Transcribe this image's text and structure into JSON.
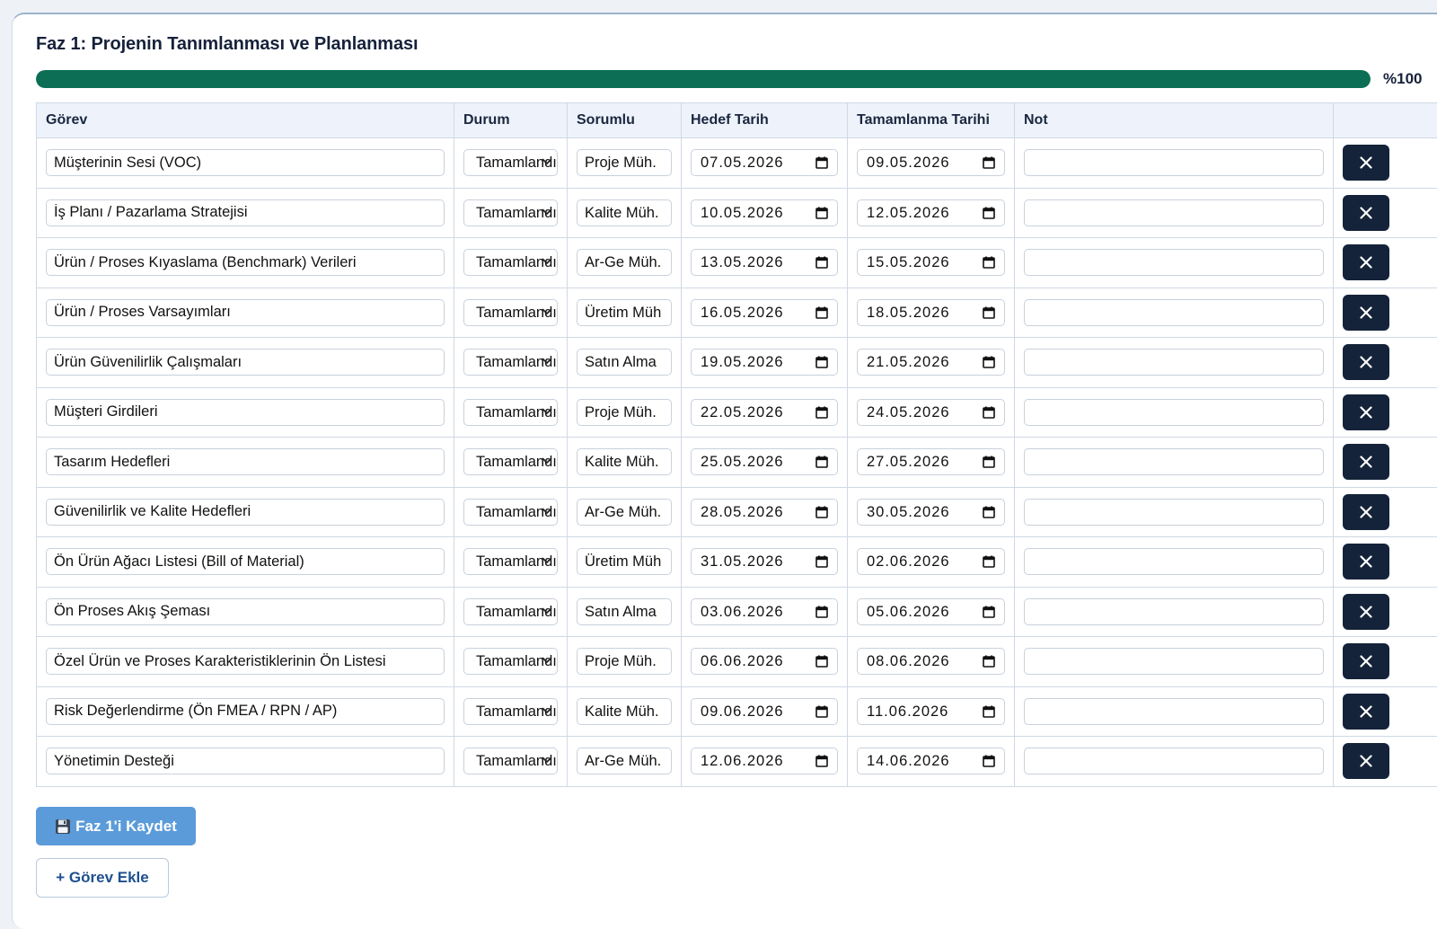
{
  "phase": {
    "title": "Faz 1: Projenin Tanımlanması ve Planlanması",
    "progress_percent": 100,
    "progress_label": "%100"
  },
  "table": {
    "headers": [
      "Görev",
      "Durum",
      "Sorumlu",
      "Hedef Tarih",
      "Tamamlanma Tarihi",
      "Not",
      ""
    ],
    "rows": [
      {
        "task": "Müşterinin Sesi (VOC)",
        "status": "Tamamlandı",
        "responsible": "Proje Müh.",
        "target_date": "07.05.2026",
        "completion_date": "09.05.2026",
        "note": ""
      },
      {
        "task": "İş Planı / Pazarlama Stratejisi",
        "status": "Tamamlandı",
        "responsible": "Kalite Müh.",
        "target_date": "10.05.2026",
        "completion_date": "12.05.2026",
        "note": ""
      },
      {
        "task": "Ürün / Proses Kıyaslama (Benchmark) Verileri",
        "status": "Tamamlandı",
        "responsible": "Ar-Ge Müh.",
        "target_date": "13.05.2026",
        "completion_date": "15.05.2026",
        "note": ""
      },
      {
        "task": "Ürün / Proses Varsayımları",
        "status": "Tamamlandı",
        "responsible": "Üretim Müh",
        "target_date": "16.05.2026",
        "completion_date": "18.05.2026",
        "note": ""
      },
      {
        "task": "Ürün Güvenilirlik Çalışmaları",
        "status": "Tamamlandı",
        "responsible": "Satın Alma",
        "target_date": "19.05.2026",
        "completion_date": "21.05.2026",
        "note": ""
      },
      {
        "task": "Müşteri Girdileri",
        "status": "Tamamlandı",
        "responsible": "Proje Müh.",
        "target_date": "22.05.2026",
        "completion_date": "24.05.2026",
        "note": ""
      },
      {
        "task": "Tasarım Hedefleri",
        "status": "Tamamlandı",
        "responsible": "Kalite Müh.",
        "target_date": "25.05.2026",
        "completion_date": "27.05.2026",
        "note": ""
      },
      {
        "task": "Güvenilirlik ve Kalite Hedefleri",
        "status": "Tamamlandı",
        "responsible": "Ar-Ge Müh.",
        "target_date": "28.05.2026",
        "completion_date": "30.05.2026",
        "note": ""
      },
      {
        "task": "Ön Ürün Ağacı Listesi (Bill of Material)",
        "status": "Tamamlandı",
        "responsible": "Üretim Müh",
        "target_date": "31.05.2026",
        "completion_date": "02.06.2026",
        "note": ""
      },
      {
        "task": "Ön Proses Akış Şeması",
        "status": "Tamamlandı",
        "responsible": "Satın Alma",
        "target_date": "03.06.2026",
        "completion_date": "05.06.2026",
        "note": ""
      },
      {
        "task": "Özel Ürün ve Proses Karakteristiklerinin Ön Listesi",
        "status": "Tamamlandı",
        "responsible": "Proje Müh.",
        "target_date": "06.06.2026",
        "completion_date": "08.06.2026",
        "note": ""
      },
      {
        "task": "Risk Değerlendirme (Ön FMEA / RPN / AP)",
        "status": "Tamamlandı",
        "responsible": "Kalite Müh.",
        "target_date": "09.06.2026",
        "completion_date": "11.06.2026",
        "note": ""
      },
      {
        "task": "Yönetimin Desteği",
        "status": "Tamamlandı",
        "responsible": "Ar-Ge Müh.",
        "target_date": "12.06.2026",
        "completion_date": "14.06.2026",
        "note": ""
      }
    ]
  },
  "actions": {
    "save_label": "Faz 1'i Kaydet",
    "add_label": "+ Görev Ekle"
  },
  "icons": {
    "delete": "close-icon",
    "status_dropdown": "chevron-down-icon",
    "date_picker": "calendar-icon",
    "save": "floppy-disk-icon"
  },
  "colors": {
    "progress": "#0b6e55",
    "primary_button": "#5b9bd9",
    "delete_button": "#142339"
  }
}
